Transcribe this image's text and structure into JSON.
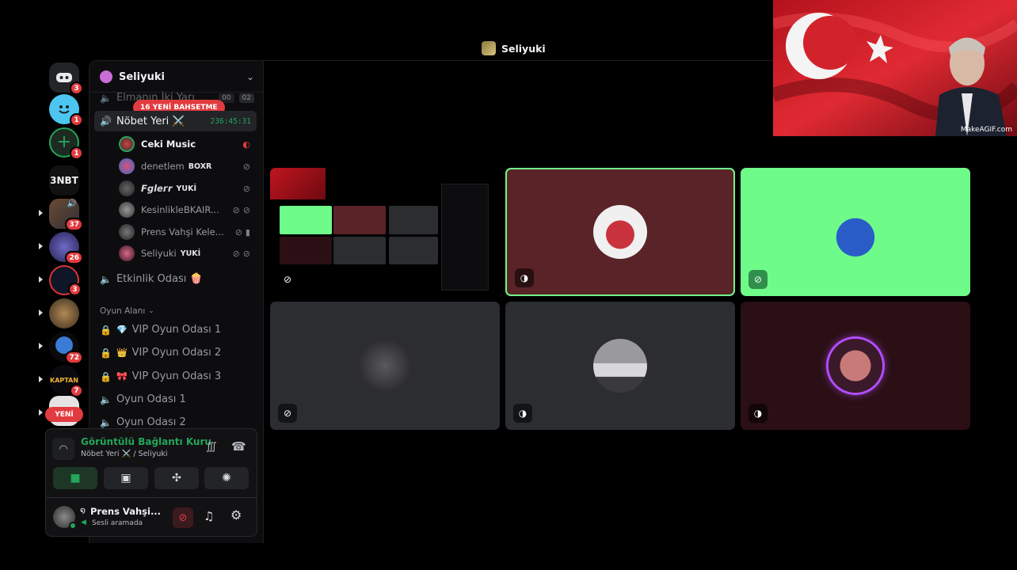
{
  "call": {
    "title": "Seliyuki"
  },
  "gif": {
    "watermark": "MakeAGIF.com"
  },
  "rail": {
    "home_badge": "3",
    "item2_badge": "1",
    "item3_badge": "1",
    "text_server": "3NBT",
    "s1_badge": "37",
    "s2_badge": "26",
    "s3_badge": "3",
    "s5_badge": "72",
    "s6_label": "KAPTAN",
    "s6_badge": "7",
    "new_pill": "YENİ"
  },
  "server": {
    "name": "Seliyuki"
  },
  "channels": {
    "top_partial": {
      "name": "Elmanın İki Yarı",
      "count_a": "00",
      "count_b": "02"
    },
    "mention_pill": "16 YENİ BAHSETME",
    "active": {
      "name": "Nöbet Yeri ⚔️",
      "timer": "236:45:31"
    },
    "event": "Etkinlik Odası 🍿",
    "category": "Oyun Alanı",
    "rooms": [
      "VIP Oyun Odası 1",
      "VIP Oyun Odası 2",
      "VIP Oyun Odası 3",
      "Oyun Odası 1",
      "Oyun Odası 2"
    ]
  },
  "voice_users": [
    {
      "name": "Ceki Music",
      "tag": ""
    },
    {
      "name": "denetlem",
      "tag": "BOXR"
    },
    {
      "name": "Fgleгr",
      "tag": "YUKİ"
    },
    {
      "name": "KesinlikleBKAIR...",
      "tag": ""
    },
    {
      "name": "Prens Vahşi Kele...",
      "tag": ""
    },
    {
      "name": "Seliyuki",
      "tag": "YUKİ"
    }
  ],
  "voice_status": {
    "title": "Görüntülü Bağlantı Kuru",
    "subtitle": "Nöbet Yeri ⚔️ / Seliyuki"
  },
  "user_panel": {
    "name": "Prens Vahşi...",
    "status": "Sesli aramada"
  },
  "colors": {
    "accent_green": "#23a55a",
    "speaking_tile": "#6ffb89",
    "maroon_tile": "#5a2328",
    "dark_tile": "#2b2d31",
    "purple_tile": "#2a0f14",
    "danger": "#e23b3f"
  },
  "icons": {
    "mic_muted": "mic-muted-icon",
    "deafen": "headphones-icon",
    "settings": "gear-icon",
    "camera": "camera-icon",
    "screen_share": "screen-share-icon",
    "activities": "activities-icon",
    "soundboard": "soundboard-icon"
  }
}
